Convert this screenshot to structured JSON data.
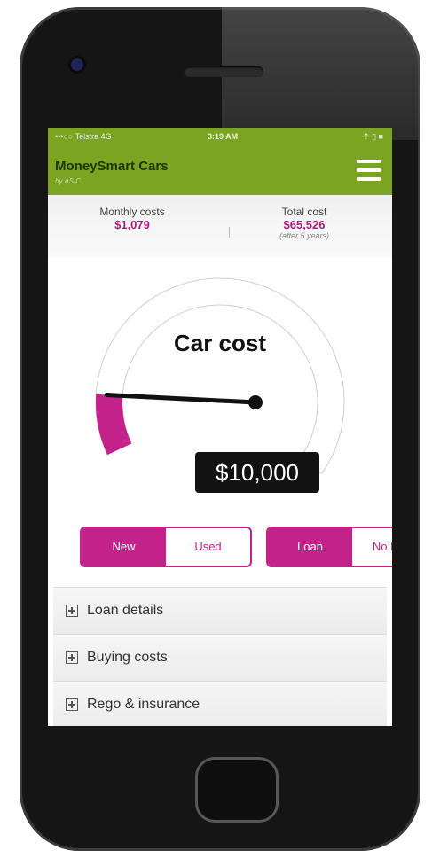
{
  "status_bar": {
    "carrier": "•••○○ Telstra  4G",
    "time": "3:19 AM",
    "right": "⇡ ▯ ■"
  },
  "header": {
    "title": "MoneySmart Cars",
    "subtitle": "by ASIC"
  },
  "summary": {
    "monthly": {
      "label": "Monthly costs",
      "value": "$1,079"
    },
    "total": {
      "label": "Total cost",
      "value": "$65,526",
      "note": "(after 5 years)"
    }
  },
  "gauge": {
    "title": "Car cost",
    "value": "$10,000",
    "level": 0.12,
    "accent": "#c3228a"
  },
  "toggles": {
    "condition": {
      "new": "New",
      "used": "Used",
      "selected": "New"
    },
    "finance": {
      "loan": "Loan",
      "no_loan": "No Loan",
      "selected": "Loan"
    }
  },
  "sections": [
    {
      "label": "Loan details"
    },
    {
      "label": "Buying costs"
    },
    {
      "label": "Rego & insurance"
    }
  ],
  "colors": {
    "header": "#7aa422",
    "accent": "#c3228a"
  }
}
